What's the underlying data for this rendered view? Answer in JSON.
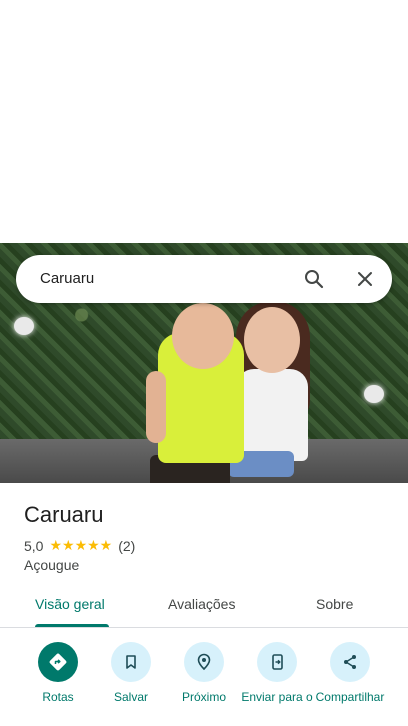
{
  "search": {
    "query": "Caruaru"
  },
  "place": {
    "title": "Caruaru",
    "rating": "5,0",
    "stars": "★★★★★",
    "review_count": "(2)",
    "category": "Açougue"
  },
  "tabs": [
    {
      "label": "Visão geral",
      "active": true
    },
    {
      "label": "Avaliações",
      "active": false
    },
    {
      "label": "Sobre",
      "active": false
    }
  ],
  "actions": [
    {
      "label": "Rotas",
      "icon": "directions-icon"
    },
    {
      "label": "Salvar",
      "icon": "bookmark-icon"
    },
    {
      "label": "Próximo",
      "icon": "nearby-icon"
    },
    {
      "label": "Enviar para o",
      "icon": "send-to-phone-icon"
    },
    {
      "label": "Compartilhar",
      "icon": "share-icon"
    }
  ],
  "colors": {
    "accent": "#00796b",
    "action_bg": "#d7f1fb",
    "star": "#fbbc04"
  }
}
